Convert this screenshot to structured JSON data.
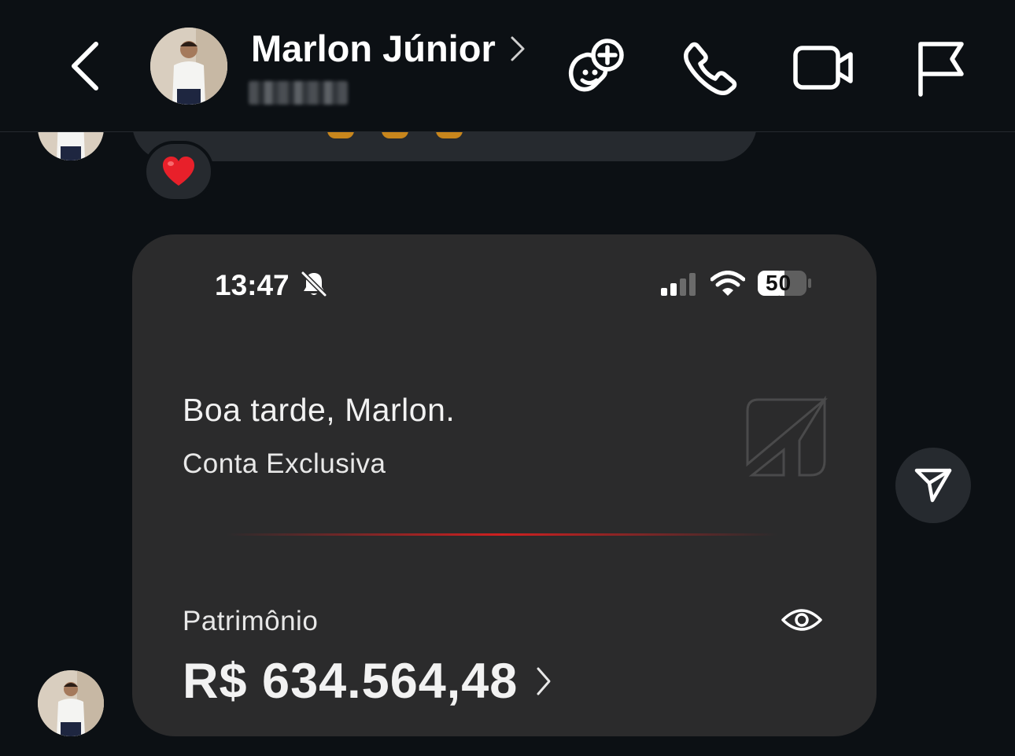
{
  "header": {
    "contact_name": "Marlon Júnior",
    "icons": {
      "back": "chevron-left-icon",
      "name_chevron": "chevron-right-icon",
      "games": "gamepad-plus-icon",
      "call": "phone-icon",
      "video": "video-camera-icon",
      "report": "flag-icon"
    }
  },
  "chat": {
    "reaction": "❤️",
    "shared_screenshot": {
      "status_bar": {
        "time": "13:47",
        "battery": "50"
      },
      "greeting": "Boa tarde, Marlon.",
      "account_type": "Conta Exclusiva",
      "balance_label": "Patrimônio",
      "balance_value": "R$ 634.564,48",
      "accent_color": "#d02020"
    }
  },
  "colors": {
    "background": "#0c1014",
    "bubble": "#262a2f",
    "card": "#2b2b2c",
    "positive": "#26d6a8"
  }
}
